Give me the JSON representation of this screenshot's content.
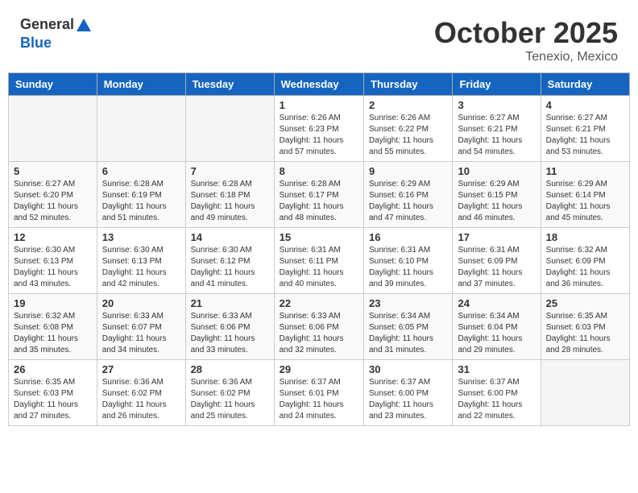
{
  "header": {
    "logo_general": "General",
    "logo_blue": "Blue",
    "month": "October 2025",
    "location": "Tenexio, Mexico"
  },
  "weekdays": [
    "Sunday",
    "Monday",
    "Tuesday",
    "Wednesday",
    "Thursday",
    "Friday",
    "Saturday"
  ],
  "weeks": [
    [
      {
        "day": "",
        "sunrise": "",
        "sunset": "",
        "daylight": ""
      },
      {
        "day": "",
        "sunrise": "",
        "sunset": "",
        "daylight": ""
      },
      {
        "day": "",
        "sunrise": "",
        "sunset": "",
        "daylight": ""
      },
      {
        "day": "1",
        "sunrise": "Sunrise: 6:26 AM",
        "sunset": "Sunset: 6:23 PM",
        "daylight": "Daylight: 11 hours and 57 minutes."
      },
      {
        "day": "2",
        "sunrise": "Sunrise: 6:26 AM",
        "sunset": "Sunset: 6:22 PM",
        "daylight": "Daylight: 11 hours and 55 minutes."
      },
      {
        "day": "3",
        "sunrise": "Sunrise: 6:27 AM",
        "sunset": "Sunset: 6:21 PM",
        "daylight": "Daylight: 11 hours and 54 minutes."
      },
      {
        "day": "4",
        "sunrise": "Sunrise: 6:27 AM",
        "sunset": "Sunset: 6:21 PM",
        "daylight": "Daylight: 11 hours and 53 minutes."
      }
    ],
    [
      {
        "day": "5",
        "sunrise": "Sunrise: 6:27 AM",
        "sunset": "Sunset: 6:20 PM",
        "daylight": "Daylight: 11 hours and 52 minutes."
      },
      {
        "day": "6",
        "sunrise": "Sunrise: 6:28 AM",
        "sunset": "Sunset: 6:19 PM",
        "daylight": "Daylight: 11 hours and 51 minutes."
      },
      {
        "day": "7",
        "sunrise": "Sunrise: 6:28 AM",
        "sunset": "Sunset: 6:18 PM",
        "daylight": "Daylight: 11 hours and 49 minutes."
      },
      {
        "day": "8",
        "sunrise": "Sunrise: 6:28 AM",
        "sunset": "Sunset: 6:17 PM",
        "daylight": "Daylight: 11 hours and 48 minutes."
      },
      {
        "day": "9",
        "sunrise": "Sunrise: 6:29 AM",
        "sunset": "Sunset: 6:16 PM",
        "daylight": "Daylight: 11 hours and 47 minutes."
      },
      {
        "day": "10",
        "sunrise": "Sunrise: 6:29 AM",
        "sunset": "Sunset: 6:15 PM",
        "daylight": "Daylight: 11 hours and 46 minutes."
      },
      {
        "day": "11",
        "sunrise": "Sunrise: 6:29 AM",
        "sunset": "Sunset: 6:14 PM",
        "daylight": "Daylight: 11 hours and 45 minutes."
      }
    ],
    [
      {
        "day": "12",
        "sunrise": "Sunrise: 6:30 AM",
        "sunset": "Sunset: 6:13 PM",
        "daylight": "Daylight: 11 hours and 43 minutes."
      },
      {
        "day": "13",
        "sunrise": "Sunrise: 6:30 AM",
        "sunset": "Sunset: 6:13 PM",
        "daylight": "Daylight: 11 hours and 42 minutes."
      },
      {
        "day": "14",
        "sunrise": "Sunrise: 6:30 AM",
        "sunset": "Sunset: 6:12 PM",
        "daylight": "Daylight: 11 hours and 41 minutes."
      },
      {
        "day": "15",
        "sunrise": "Sunrise: 6:31 AM",
        "sunset": "Sunset: 6:11 PM",
        "daylight": "Daylight: 11 hours and 40 minutes."
      },
      {
        "day": "16",
        "sunrise": "Sunrise: 6:31 AM",
        "sunset": "Sunset: 6:10 PM",
        "daylight": "Daylight: 11 hours and 39 minutes."
      },
      {
        "day": "17",
        "sunrise": "Sunrise: 6:31 AM",
        "sunset": "Sunset: 6:09 PM",
        "daylight": "Daylight: 11 hours and 37 minutes."
      },
      {
        "day": "18",
        "sunrise": "Sunrise: 6:32 AM",
        "sunset": "Sunset: 6:09 PM",
        "daylight": "Daylight: 11 hours and 36 minutes."
      }
    ],
    [
      {
        "day": "19",
        "sunrise": "Sunrise: 6:32 AM",
        "sunset": "Sunset: 6:08 PM",
        "daylight": "Daylight: 11 hours and 35 minutes."
      },
      {
        "day": "20",
        "sunrise": "Sunrise: 6:33 AM",
        "sunset": "Sunset: 6:07 PM",
        "daylight": "Daylight: 11 hours and 34 minutes."
      },
      {
        "day": "21",
        "sunrise": "Sunrise: 6:33 AM",
        "sunset": "Sunset: 6:06 PM",
        "daylight": "Daylight: 11 hours and 33 minutes."
      },
      {
        "day": "22",
        "sunrise": "Sunrise: 6:33 AM",
        "sunset": "Sunset: 6:06 PM",
        "daylight": "Daylight: 11 hours and 32 minutes."
      },
      {
        "day": "23",
        "sunrise": "Sunrise: 6:34 AM",
        "sunset": "Sunset: 6:05 PM",
        "daylight": "Daylight: 11 hours and 31 minutes."
      },
      {
        "day": "24",
        "sunrise": "Sunrise: 6:34 AM",
        "sunset": "Sunset: 6:04 PM",
        "daylight": "Daylight: 11 hours and 29 minutes."
      },
      {
        "day": "25",
        "sunrise": "Sunrise: 6:35 AM",
        "sunset": "Sunset: 6:03 PM",
        "daylight": "Daylight: 11 hours and 28 minutes."
      }
    ],
    [
      {
        "day": "26",
        "sunrise": "Sunrise: 6:35 AM",
        "sunset": "Sunset: 6:03 PM",
        "daylight": "Daylight: 11 hours and 27 minutes."
      },
      {
        "day": "27",
        "sunrise": "Sunrise: 6:36 AM",
        "sunset": "Sunset: 6:02 PM",
        "daylight": "Daylight: 11 hours and 26 minutes."
      },
      {
        "day": "28",
        "sunrise": "Sunrise: 6:36 AM",
        "sunset": "Sunset: 6:02 PM",
        "daylight": "Daylight: 11 hours and 25 minutes."
      },
      {
        "day": "29",
        "sunrise": "Sunrise: 6:37 AM",
        "sunset": "Sunset: 6:01 PM",
        "daylight": "Daylight: 11 hours and 24 minutes."
      },
      {
        "day": "30",
        "sunrise": "Sunrise: 6:37 AM",
        "sunset": "Sunset: 6:00 PM",
        "daylight": "Daylight: 11 hours and 23 minutes."
      },
      {
        "day": "31",
        "sunrise": "Sunrise: 6:37 AM",
        "sunset": "Sunset: 6:00 PM",
        "daylight": "Daylight: 11 hours and 22 minutes."
      },
      {
        "day": "",
        "sunrise": "",
        "sunset": "",
        "daylight": ""
      }
    ]
  ]
}
